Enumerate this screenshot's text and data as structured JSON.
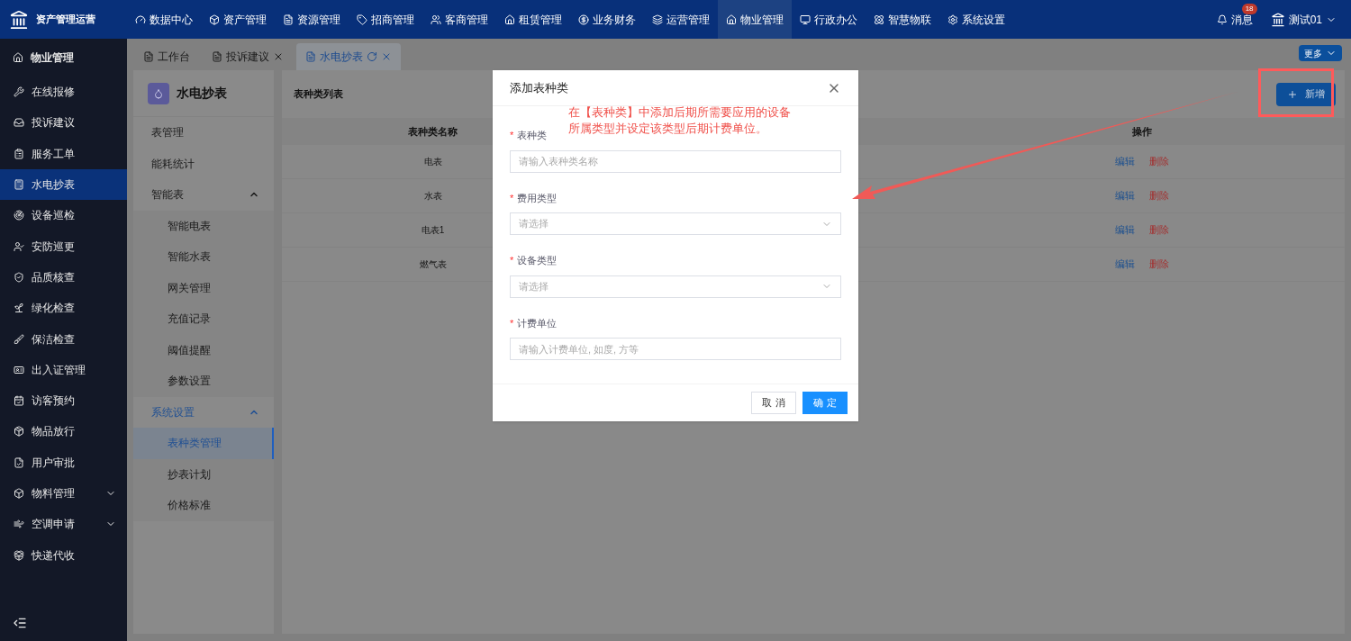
{
  "app": {
    "title": "资产管理运营"
  },
  "top_nav": [
    {
      "label": "数据中心",
      "selected": false
    },
    {
      "label": "资产管理",
      "selected": false
    },
    {
      "label": "资源管理",
      "selected": false
    },
    {
      "label": "招商管理",
      "selected": false
    },
    {
      "label": "客商管理",
      "selected": false
    },
    {
      "label": "租赁管理",
      "selected": false
    },
    {
      "label": "业务财务",
      "selected": false
    },
    {
      "label": "运营管理",
      "selected": false
    },
    {
      "label": "物业管理",
      "selected": true
    },
    {
      "label": "行政办公",
      "selected": false
    },
    {
      "label": "智慧物联",
      "selected": false
    },
    {
      "label": "系统设置",
      "selected": false
    }
  ],
  "messages": {
    "label": "消息",
    "badge": "18"
  },
  "user": {
    "name": "测试01"
  },
  "sidebar": {
    "header": "物业管理",
    "items": [
      {
        "label": "在线报修",
        "selected": false
      },
      {
        "label": "投诉建议",
        "selected": false
      },
      {
        "label": "服务工单",
        "selected": false
      },
      {
        "label": "水电抄表",
        "selected": true
      },
      {
        "label": "设备巡检",
        "selected": false
      },
      {
        "label": "安防巡更",
        "selected": false
      },
      {
        "label": "品质核查",
        "selected": false
      },
      {
        "label": "绿化检查",
        "selected": false
      },
      {
        "label": "保洁检查",
        "selected": false
      },
      {
        "label": "出入证管理",
        "selected": false
      },
      {
        "label": "访客预约",
        "selected": false
      },
      {
        "label": "物品放行",
        "selected": false
      },
      {
        "label": "用户审批",
        "selected": false
      },
      {
        "label": "物料管理",
        "selected": false,
        "expandable": true
      },
      {
        "label": "空调申请",
        "selected": false,
        "expandable": true
      },
      {
        "label": "快递代收",
        "selected": false
      }
    ]
  },
  "tabs": [
    {
      "label": "工作台",
      "selected": false,
      "closable": false
    },
    {
      "label": "投诉建议",
      "selected": false,
      "closable": true
    },
    {
      "label": "水电抄表",
      "selected": true,
      "closable": true
    }
  ],
  "more_button": "更多",
  "sub_menu": {
    "title": "水电抄表",
    "items": [
      {
        "label": "表管理",
        "selected": false
      },
      {
        "label": "能耗统计",
        "selected": false
      },
      {
        "label": "智能表",
        "selected": false,
        "expanded": true,
        "children": [
          {
            "label": "智能电表",
            "selected": false
          },
          {
            "label": "智能水表",
            "selected": false
          },
          {
            "label": "网关管理",
            "selected": false
          },
          {
            "label": "充值记录",
            "selected": false
          },
          {
            "label": "阈值提醒",
            "selected": false
          },
          {
            "label": "参数设置",
            "selected": false
          }
        ]
      },
      {
        "label": "系统设置",
        "selected": false,
        "expanded": true,
        "children": [
          {
            "label": "表种类管理",
            "selected": true
          },
          {
            "label": "抄表计划",
            "selected": false
          },
          {
            "label": "价格标准",
            "selected": false
          }
        ]
      }
    ]
  },
  "list": {
    "title": "表种类列表",
    "add_button": "新增",
    "columns": [
      "表种类名称",
      "操作"
    ],
    "rows": [
      {
        "name": "电表",
        "actions": [
          "编辑",
          "删除"
        ]
      },
      {
        "name": "水表",
        "actions": [
          "编辑",
          "删除"
        ]
      },
      {
        "name": "电表1",
        "actions": [
          "编辑",
          "删除"
        ]
      },
      {
        "name": "燃气表",
        "actions": [
          "编辑",
          "删除"
        ]
      }
    ]
  },
  "dialog": {
    "title": "添加表种类",
    "fields": [
      {
        "mark": "*",
        "label": "表种类",
        "kind": "input",
        "placeholder": "请输入表种类名称"
      },
      {
        "mark": "*",
        "label": "费用类型",
        "kind": "select",
        "placeholder": "请选择"
      },
      {
        "mark": "*",
        "label": "设备类型",
        "kind": "select",
        "placeholder": "请选择"
      },
      {
        "mark": "*",
        "label": "计费单位",
        "kind": "input",
        "placeholder": "请输入计费单位, 如度, 方等"
      }
    ],
    "cancel": "取 消",
    "confirm": "确 定"
  },
  "annotation": {
    "lines": [
      "在【表种类】中添加后期所需要应用的设备",
      "所属类型并设定该类型后期计费单位。"
    ]
  }
}
